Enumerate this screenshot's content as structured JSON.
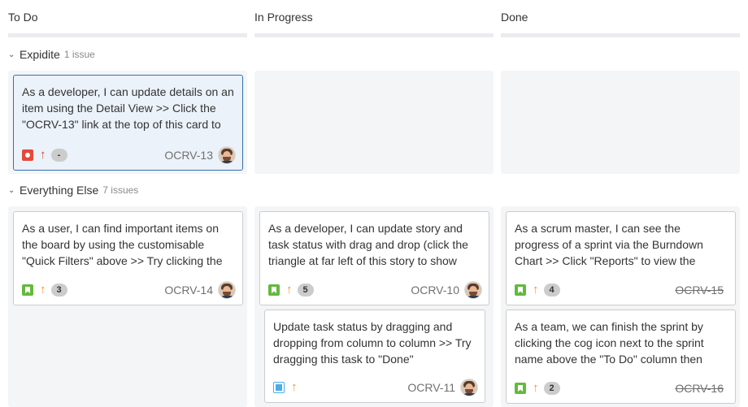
{
  "columns": [
    {
      "name": "To Do"
    },
    {
      "name": "In Progress"
    },
    {
      "name": "Done"
    }
  ],
  "swimlanes": [
    {
      "name": "Expidite",
      "count": "1 issue"
    },
    {
      "name": "Everything Else",
      "count": "7 issues"
    }
  ],
  "cards": {
    "ocrv13": {
      "summary": "As a developer, I can update details on an item using the Detail View >> Click the \"OCRV-13\" link at the top of this card to",
      "key": "OCRV-13",
      "type": "bug-icon",
      "priority": "highest",
      "badge": "-"
    },
    "ocrv14": {
      "summary": "As a user, I can find important items on the board by using the customisable \"Quick Filters\" above >> Try clicking the",
      "key": "OCRV-14",
      "type": "story-icon",
      "priority": "high",
      "badge": "3"
    },
    "ocrv10": {
      "summary": "As a developer, I can update story and task status with drag and drop (click the triangle at far left of this story to show",
      "key": "OCRV-10",
      "type": "story-icon",
      "priority": "high",
      "badge": "5"
    },
    "ocrv11": {
      "summary": "Update task status by dragging and dropping from column to column >> Try dragging this task to \"Done\"",
      "key": "OCRV-11",
      "type": "subtask-icon",
      "priority": "high"
    },
    "ocrv15": {
      "summary": "As a scrum master, I can see the progress of a sprint via the Burndown Chart >> Click \"Reports\" to view the",
      "key": "OCRV-15",
      "type": "story-icon",
      "priority": "high",
      "badge": "4"
    },
    "ocrv16": {
      "summary": "As a team, we can finish the sprint by clicking the cog icon next to the sprint name above the \"To Do\" column then",
      "key": "OCRV-16",
      "type": "story-icon",
      "priority": "high",
      "badge": "2"
    }
  },
  "icons": {
    "priority_arrow": "↑",
    "chevron": "⌄"
  },
  "colors": {
    "selected_border": "#3572b0",
    "bug": "#e5493a",
    "story": "#63ba3c",
    "subtask": "#4bade8",
    "priority_highest": "#d04437",
    "priority_high": "#f79232"
  }
}
